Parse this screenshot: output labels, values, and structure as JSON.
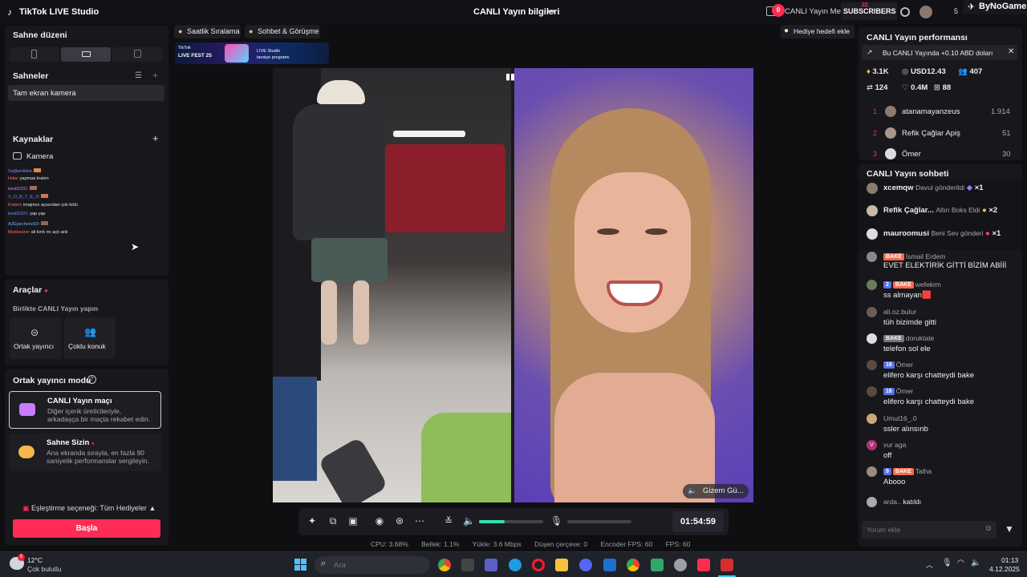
{
  "app": {
    "title": "TikTok LIVE Studio",
    "center_title": "CANLI Yayın bilgileri"
  },
  "topbar": {
    "notif_count": "0",
    "live_center": "CANLI Yayın Merkezi",
    "subs_label": "SUBSCRIBERS",
    "subs_count": "22",
    "number": "5",
    "brand": "ByNoGame"
  },
  "left": {
    "scene_layout": "Sahne düzeni",
    "scenes": "Sahneler",
    "scene_item": "Tam ekran kamera",
    "sources": "Kaynaklar",
    "source_camera": "Kamera",
    "mini_chat": [
      {
        "user": "Sağlamlıklar",
        "msg": ""
      },
      {
        "user": "Hata",
        "msg": ": yapmaa kralım"
      },
      {
        "user": "bestt2331",
        "msg": ":"
      },
      {
        "user": "V_O_R_T_E_X",
        "msg": ":"
      },
      {
        "user": "Kralım",
        "msg": ": imajımız açısından çok kötü"
      },
      {
        "user": "bestt2331",
        "msg": ": yap yap"
      },
      {
        "user": "AZEpecheno03",
        "msg": ":"
      },
      {
        "user": "Mudavane",
        "msg": ": ali kırık mı açtı anlı"
      }
    ],
    "tools": "Araçlar",
    "together_live": "Birlikte CANLI Yayın yapın",
    "cohost": "Ortak yayıncı",
    "multi_guest": "Çoklu konuk",
    "cohost_mode": "Ortak yayıncı modu",
    "match_title": "CANLI Yayın maçı",
    "match_desc1": "Diğer içerik üreticileriyle,",
    "match_desc2": "arkadaşça bir maçta rekabet edin.",
    "stage_title": "Sahne Sizin",
    "stage_desc1": "Ana ekranda sırayla, en fazla 90",
    "stage_desc2": "saniyelik performanslar sergileyin.",
    "match_option": "Eşleştirme seçeneği: Tüm Hediyeler",
    "start_button": "Başla"
  },
  "center": {
    "hourly_rank": "Saatlik Sıralama",
    "chat_talk": "Sohbet & Görüşme",
    "gift_goal": "Hediye hedefi ekle",
    "banner_line1": "TikTok",
    "banner_line2": "LIVE FEST 25",
    "banner_right1": "LIVE Studio",
    "banner_right2": "tavsiye programı",
    "guest_name": "Gizem Gü...",
    "timer": "01:54:59",
    "volume_pct": 0.4,
    "stats": {
      "cpu": "CPU: 3.68%",
      "mem": "Bellek: 1.1%",
      "upload": "Yükle: 3.6 Mbps",
      "dropped": "Düşen çerçeve: 0",
      "encoder_fps": "Encoder FPS: 60",
      "fps": "FPS: 60"
    }
  },
  "right": {
    "perf_title": "CANLI Yayın performansı",
    "promo": "Bu CANLI Yayında +0.10 ABD doları",
    "stat_diamonds": "3.1K",
    "stat_usd": "USD12.43",
    "stat_viewers": "407",
    "stat_chat": "124",
    "stat_likes": "0.4M",
    "stat_followers": "88",
    "ranking": [
      {
        "rank": "1",
        "name": "atanamayanzeus",
        "score": "1.914"
      },
      {
        "rank": "2",
        "name": "Refik Çağlar Apiş",
        "score": "51"
      },
      {
        "rank": "3",
        "name": "Ömer",
        "score": "30"
      }
    ],
    "chat_title": "CANLI Yayın sohbeti",
    "gifts": [
      {
        "user": "xcemqw",
        "text": "Davul gönderildi",
        "count": "×1"
      },
      {
        "user": "Refik Çağlar...",
        "text": "Altın Boks Eldi",
        "count": "×2"
      },
      {
        "user": "mauroomusi",
        "text": "Beni Sev gönderi",
        "count": "×1"
      }
    ],
    "messages": [
      {
        "lvl": "",
        "bake": true,
        "user": "İsmail Erdem",
        "msg": "EVET ELEKTİRİK GİTTİ BİZİM ABİİİ"
      },
      {
        "lvl": "2",
        "bake": true,
        "user": "wefekrm",
        "msg": "ss almayan🟥"
      },
      {
        "lvl": "",
        "bake": false,
        "user": "ali.oz.bulur",
        "msg": "tüh bizimde gitti"
      },
      {
        "lvl": "",
        "bake": true,
        "user": "doruktate",
        "msg": "telefon sol ele"
      },
      {
        "lvl": "16",
        "bake": false,
        "user": "Ömer",
        "msg": "elifero karşı chatteydi bake"
      },
      {
        "lvl": "16",
        "bake": false,
        "user": "Ömer",
        "msg": "elifero karşı chatteydi bake"
      },
      {
        "lvl": "",
        "bake": false,
        "user": "Umut16_.0",
        "msg": "ssler alınsınb"
      },
      {
        "lvl": "",
        "bake": false,
        "user": "vur aga",
        "msg": "off"
      },
      {
        "lvl": "9",
        "bake": true,
        "user": "Talha",
        "msg": "Abooo"
      }
    ],
    "joined_user": "arda..",
    "joined_text": "katıldı",
    "comment_placeholder": "Yorum ekle",
    "bake_label": "BAKE"
  },
  "taskbar": {
    "weather_temp": "12°C",
    "weather_desc": "Çok bulutlu",
    "weather_badge": "5",
    "search_placeholder": "Ara",
    "time": "01:13",
    "date": "4.12.2025"
  }
}
